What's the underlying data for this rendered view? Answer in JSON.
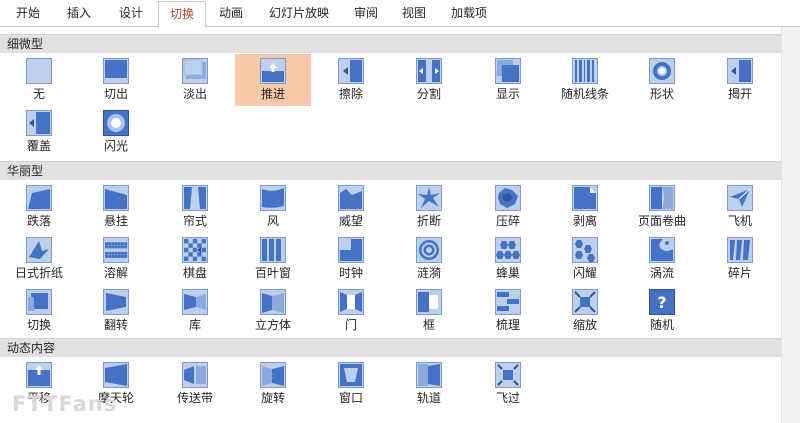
{
  "ribbon": {
    "tabs": [
      {
        "label": "开始"
      },
      {
        "label": "插入"
      },
      {
        "label": "设计"
      },
      {
        "label": "切换"
      },
      {
        "label": "动画"
      },
      {
        "label": "幻灯片放映"
      },
      {
        "label": "审阅"
      },
      {
        "label": "视图"
      },
      {
        "label": "加载项"
      }
    ],
    "active_tab": "切换"
  },
  "colors": {
    "accent": "#b7472a",
    "selected": "#f8c8a8",
    "icon_blue": "#4472c4",
    "section": "#e1e1e1"
  },
  "sections": [
    {
      "title": "细微型",
      "items": [
        {
          "label": "无",
          "icon": "none-icon"
        },
        {
          "label": "切出",
          "icon": "cut-icon"
        },
        {
          "label": "淡出",
          "icon": "fade-icon"
        },
        {
          "label": "推进",
          "icon": "push-icon"
        },
        {
          "label": "擦除",
          "icon": "wipe-icon"
        },
        {
          "label": "分割",
          "icon": "split-icon"
        },
        {
          "label": "显示",
          "icon": "reveal-icon"
        },
        {
          "label": "随机线条",
          "icon": "random-bars-icon"
        },
        {
          "label": "形状",
          "icon": "shape-icon"
        },
        {
          "label": "揭开",
          "icon": "uncover-icon"
        },
        {
          "label": "覆盖",
          "icon": "cover-icon"
        },
        {
          "label": "闪光",
          "icon": "flash-icon"
        }
      ]
    },
    {
      "title": "华丽型",
      "items": [
        {
          "label": "跌落",
          "icon": "fall-over-icon"
        },
        {
          "label": "悬挂",
          "icon": "drape-icon"
        },
        {
          "label": "帘式",
          "icon": "curtains-icon"
        },
        {
          "label": "风",
          "icon": "wind-icon"
        },
        {
          "label": "威望",
          "icon": "prestige-icon"
        },
        {
          "label": "折断",
          "icon": "fracture-icon"
        },
        {
          "label": "压碎",
          "icon": "crush-icon"
        },
        {
          "label": "剥离",
          "icon": "peel-off-icon"
        },
        {
          "label": "页面卷曲",
          "icon": "page-curl-icon"
        },
        {
          "label": "飞机",
          "icon": "airplane-icon"
        },
        {
          "label": "日式折纸",
          "icon": "origami-icon"
        },
        {
          "label": "溶解",
          "icon": "dissolve-icon"
        },
        {
          "label": "棋盘",
          "icon": "checkerboard-icon"
        },
        {
          "label": "百叶窗",
          "icon": "blinds-icon"
        },
        {
          "label": "时钟",
          "icon": "clock-icon"
        },
        {
          "label": "涟漪",
          "icon": "ripple-icon"
        },
        {
          "label": "蜂巢",
          "icon": "honeycomb-icon"
        },
        {
          "label": "闪耀",
          "icon": "glitter-icon"
        },
        {
          "label": "涡流",
          "icon": "vortex-icon"
        },
        {
          "label": "碎片",
          "icon": "shred-icon"
        },
        {
          "label": "切换",
          "icon": "switch-icon"
        },
        {
          "label": "翻转",
          "icon": "flip-icon"
        },
        {
          "label": "库",
          "icon": "gallery-icon"
        },
        {
          "label": "立方体",
          "icon": "cube-icon"
        },
        {
          "label": "门",
          "icon": "doors-icon"
        },
        {
          "label": "框",
          "icon": "box-icon"
        },
        {
          "label": "梳理",
          "icon": "comb-icon"
        },
        {
          "label": "缩放",
          "icon": "zoom-icon"
        },
        {
          "label": "随机",
          "icon": "random-icon"
        }
      ]
    },
    {
      "title": "动态内容",
      "items": [
        {
          "label": "平移",
          "icon": "pan-icon"
        },
        {
          "label": "摩天轮",
          "icon": "ferris-wheel-icon"
        },
        {
          "label": "传送带",
          "icon": "conveyor-icon"
        },
        {
          "label": "旋转",
          "icon": "rotate-icon"
        },
        {
          "label": "窗口",
          "icon": "window-icon"
        },
        {
          "label": "轨道",
          "icon": "orbit-icon"
        },
        {
          "label": "飞过",
          "icon": "fly-through-icon"
        }
      ]
    }
  ],
  "selected_item": "推进",
  "watermark": "FTTFans"
}
